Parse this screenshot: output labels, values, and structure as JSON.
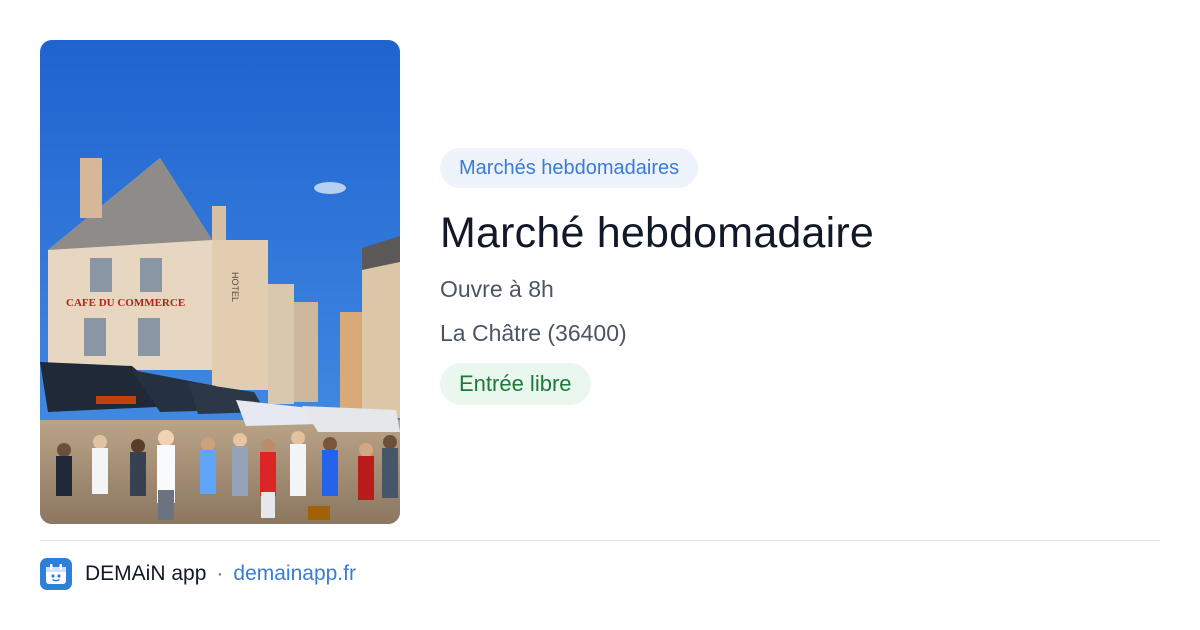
{
  "card": {
    "category": "Marchés hebdomadaires",
    "title": "Marché hebdomadaire",
    "opening": "Ouvre à 8h",
    "location": "La Châtre (36400)",
    "entry": "Entrée libre"
  },
  "photo": {
    "storefront_sign": "CAFE DU COMMERCE",
    "hotel_sign": "HOTEL"
  },
  "footer": {
    "app_name": "DEMAiN app",
    "separator": "·",
    "link": "demainapp.fr"
  },
  "colors": {
    "accent": "#3b7bd4",
    "category_bg": "#eef3fb",
    "entry_text": "#1f7a3a",
    "entry_bg": "#eaf7ee",
    "title": "#111827",
    "meta": "#4b5563"
  }
}
